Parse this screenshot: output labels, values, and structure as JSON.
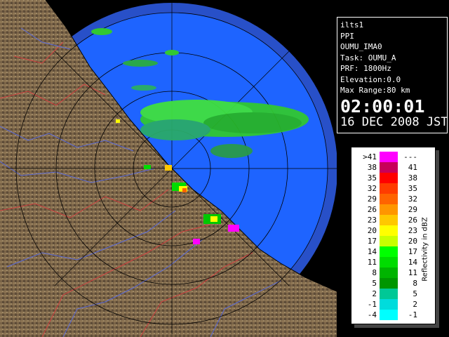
{
  "info_panel": {
    "lines": [
      "ilts1",
      "PPI",
      "OUMU_IMA0",
      "Task: OUMU_A",
      "PRF: 1800Hz",
      "Elevation:0.0",
      "Max Range:80 km"
    ],
    "time": "02:00:01",
    "date": "16 DEC 2008 JST"
  },
  "legend": {
    "unit": "Reflectivity in dBZ",
    "rows": [
      {
        "lo": ">41",
        "hi": "---",
        "color": "#ff00ff"
      },
      {
        "lo": "38",
        "hi": "41",
        "color": "#c8005a"
      },
      {
        "lo": "35",
        "hi": "38",
        "color": "#ff0000"
      },
      {
        "lo": "32",
        "hi": "35",
        "color": "#ff3c00"
      },
      {
        "lo": "29",
        "hi": "32",
        "color": "#ff6400"
      },
      {
        "lo": "26",
        "hi": "29",
        "color": "#ff9600"
      },
      {
        "lo": "23",
        "hi": "26",
        "color": "#ffc800"
      },
      {
        "lo": "20",
        "hi": "23",
        "color": "#ffff00"
      },
      {
        "lo": "17",
        "hi": "20",
        "color": "#c8ff00"
      },
      {
        "lo": "14",
        "hi": "17",
        "color": "#00ff00"
      },
      {
        "lo": "11",
        "hi": "14",
        "color": "#00dc00"
      },
      {
        "lo": "8",
        "hi": "11",
        "color": "#00b400"
      },
      {
        "lo": "5",
        "hi": "8",
        "color": "#009600"
      },
      {
        "lo": "2",
        "hi": "5",
        "color": "#00c896"
      },
      {
        "lo": "-1",
        "hi": "2",
        "color": "#00dcdc"
      },
      {
        "lo": "-4",
        "hi": "-1",
        "color": "#00ffff"
      }
    ]
  },
  "map": {
    "sea_color": "#1e64ff",
    "outer_range_color": "#2850c8",
    "land_color": "#7a6448",
    "echo_color": "#32c832"
  }
}
